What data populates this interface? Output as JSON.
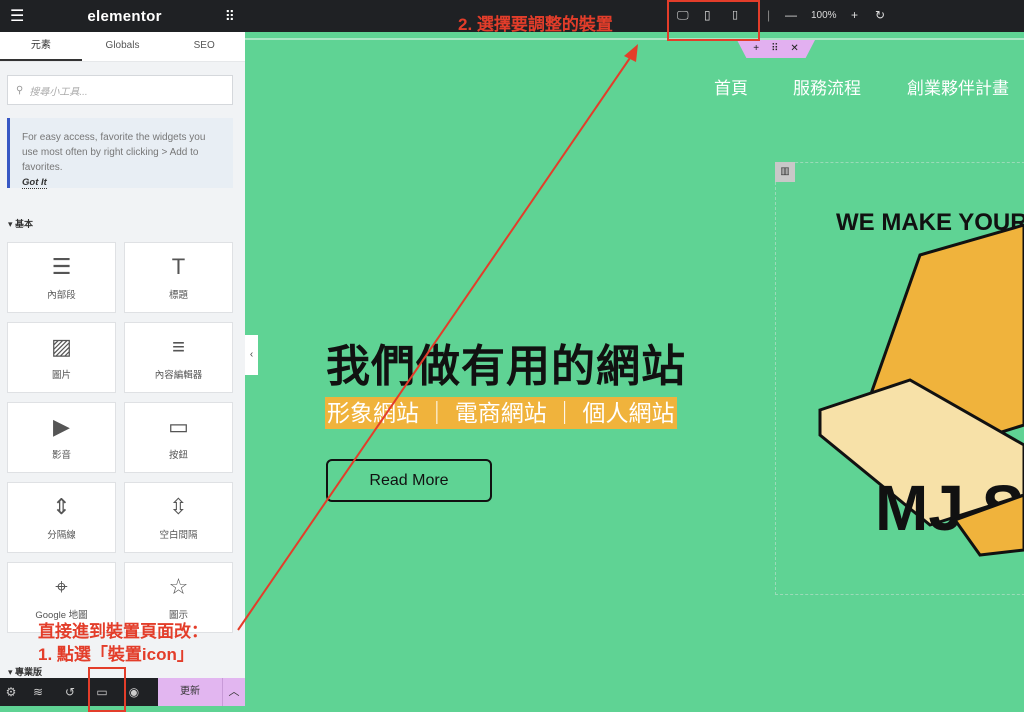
{
  "sidebar": {
    "logo": "elementor",
    "tabs": [
      {
        "label": "元素"
      },
      {
        "label": "Globals"
      },
      {
        "label": "SEO"
      }
    ],
    "search_placeholder": "搜尋小工具...",
    "info": {
      "text": "For easy access, favorite the widgets you use most often by right clicking > Add to favorites.",
      "action": "Got It"
    },
    "category_basic": "基本",
    "category_pro": "專業版",
    "widgets": [
      {
        "label": "內部段",
        "icon": "inner-section-icon"
      },
      {
        "label": "標題",
        "icon": "heading-icon"
      },
      {
        "label": "圖片",
        "icon": "image-icon"
      },
      {
        "label": "內容編輯器",
        "icon": "text-editor-icon"
      },
      {
        "label": "影音",
        "icon": "video-icon"
      },
      {
        "label": "按鈕",
        "icon": "button-icon"
      },
      {
        "label": "分隔線",
        "icon": "divider-icon"
      },
      {
        "label": "空白間隔",
        "icon": "spacer-icon"
      },
      {
        "label": "Google 地圖",
        "icon": "map-icon"
      },
      {
        "label": "圖示",
        "icon": "star-icon"
      }
    ],
    "update_label": "更新"
  },
  "topbar": {
    "zoom": "100%"
  },
  "page": {
    "nav": [
      "首頁",
      "服務流程",
      "創業夥伴計畫"
    ],
    "heading": "我們做有用的網站",
    "subtitle": "形象網站 ｜ 電商網站 ｜ 個人網站",
    "button": "Read More",
    "illustration_text": [
      "WE MAKE YOUR",
      "MJ S"
    ]
  },
  "annotations": {
    "step1_line1": "直接進到裝置頁面改：",
    "step1_line2": "1. 點選「裝置icon」",
    "step2": "2. 選擇要調整的裝置"
  },
  "colors": {
    "canvas": "#5fd394",
    "highlight": "#f0b33c",
    "annotation": "#e33d2a",
    "accent": "#e2b6f0"
  }
}
